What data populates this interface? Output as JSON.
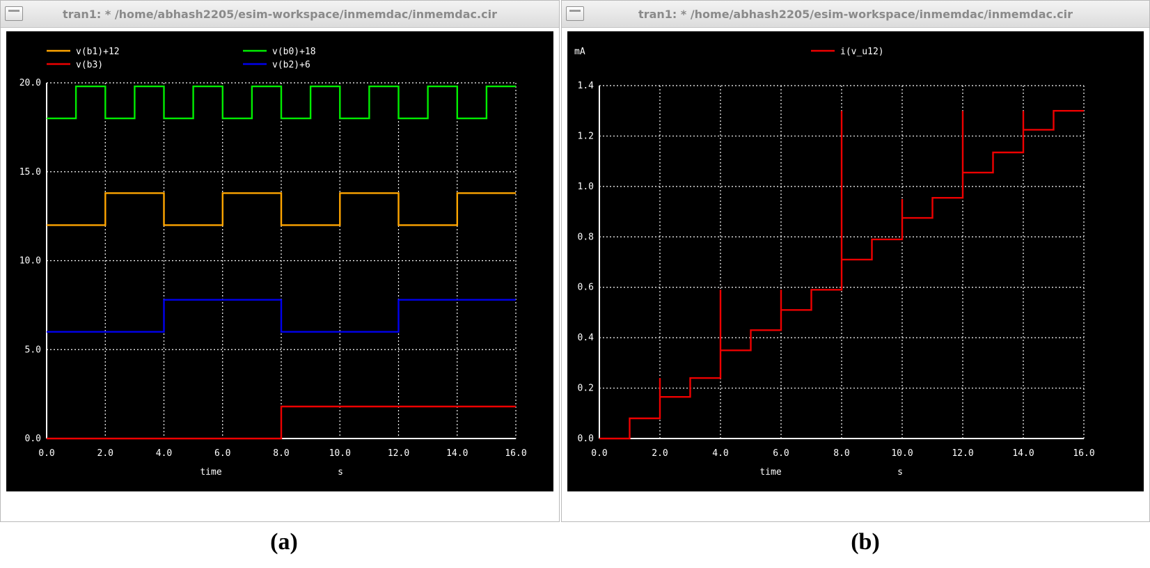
{
  "panels": [
    {
      "window_title": "tran1: * /home/abhash2205/esim-workspace/inmemdac/inmemdac.cir",
      "caption": "(a)"
    },
    {
      "window_title": "tran1: * /home/abhash2205/esim-workspace/inmemdac/inmemdac.cir",
      "caption": "(b)"
    }
  ],
  "colors": {
    "plot_background": "#000000",
    "axis": "#ffffff",
    "grid": "#ffffff",
    "text": "#ffffff"
  },
  "chart_data": [
    {
      "type": "line",
      "xlabel": "time",
      "xunit": "s",
      "ylabel": "",
      "xlim": [
        0,
        16
      ],
      "ylim": [
        0,
        20
      ],
      "xticks": [
        "0.0",
        "2.0",
        "4.0",
        "6.0",
        "8.0",
        "10.0",
        "12.0",
        "14.0",
        "16.0"
      ],
      "yticks": [
        "0.0",
        "5.0",
        "10.0",
        "15.0",
        "20.0"
      ],
      "grid": true,
      "legend_position": "top",
      "series": [
        {
          "name": "v(b1)+12",
          "color": "#ffa500",
          "x": [
            0,
            2,
            2,
            3,
            3,
            4,
            4,
            6,
            6,
            7,
            7,
            8,
            8,
            10,
            10,
            11,
            11,
            12,
            12,
            14,
            14,
            16
          ],
          "y": [
            12,
            12,
            13.8,
            13.8,
            13.8,
            13.8,
            12,
            12,
            13.8,
            13.8,
            13.8,
            13.8,
            12,
            12,
            13.8,
            13.8,
            13.8,
            13.8,
            12,
            12,
            13.8,
            13.8
          ]
        },
        {
          "name": "v(b0)+18",
          "color": "#00ee00",
          "x": [
            0,
            1,
            1,
            2,
            2,
            3,
            3,
            4,
            4,
            5,
            5,
            6,
            6,
            7,
            7,
            8,
            8,
            9,
            9,
            10,
            10,
            11,
            11,
            12,
            12,
            13,
            13,
            14,
            14,
            15,
            15,
            16
          ],
          "y": [
            18,
            18,
            19.8,
            19.8,
            18,
            18,
            19.8,
            19.8,
            18,
            18,
            19.8,
            19.8,
            18,
            18,
            19.8,
            19.8,
            18,
            18,
            19.8,
            19.8,
            18,
            18,
            19.8,
            19.8,
            18,
            18,
            19.8,
            19.8,
            18,
            18,
            19.8,
            19.8
          ]
        },
        {
          "name": "v(b3)",
          "color": "#ee0000",
          "x": [
            0,
            8,
            8,
            16
          ],
          "y": [
            0,
            0,
            1.8,
            1.8
          ]
        },
        {
          "name": "v(b2)+6",
          "color": "#0000ee",
          "x": [
            0,
            4,
            4,
            8,
            8,
            12,
            12,
            16
          ],
          "y": [
            6,
            6,
            7.8,
            7.8,
            6,
            6,
            7.8,
            7.8
          ]
        }
      ]
    },
    {
      "type": "line",
      "xlabel": "time",
      "xunit": "s",
      "ylabel": "mA",
      "xlim": [
        0,
        16
      ],
      "ylim": [
        0,
        1.4
      ],
      "xticks": [
        "0.0",
        "2.0",
        "4.0",
        "6.0",
        "8.0",
        "10.0",
        "12.0",
        "14.0",
        "16.0"
      ],
      "yticks": [
        "0.0",
        "0.2",
        "0.4",
        "0.6",
        "0.8",
        "1.0",
        "1.2",
        "1.4"
      ],
      "grid": true,
      "legend_position": "top",
      "series": [
        {
          "name": "i(v_u12)",
          "color": "#ee0000",
          "x": [
            0,
            1,
            1,
            2,
            2,
            2,
            3,
            3,
            4,
            4,
            4,
            5,
            5,
            6,
            6,
            6,
            7,
            7,
            8,
            8,
            8,
            9,
            9,
            10,
            10,
            10,
            11,
            11,
            12,
            12,
            12,
            13,
            13,
            14,
            14,
            14,
            15,
            15,
            16
          ],
          "y": [
            0,
            0,
            0.08,
            0.08,
            0.24,
            0.165,
            0.165,
            0.24,
            0.24,
            0.59,
            0.35,
            0.35,
            0.43,
            0.43,
            0.59,
            0.51,
            0.51,
            0.59,
            0.59,
            1.3,
            0.71,
            0.71,
            0.79,
            0.79,
            0.95,
            0.875,
            0.875,
            0.955,
            0.955,
            1.3,
            1.055,
            1.055,
            1.135,
            1.135,
            1.3,
            1.225,
            1.225,
            1.3,
            1.3
          ]
        }
      ]
    }
  ]
}
